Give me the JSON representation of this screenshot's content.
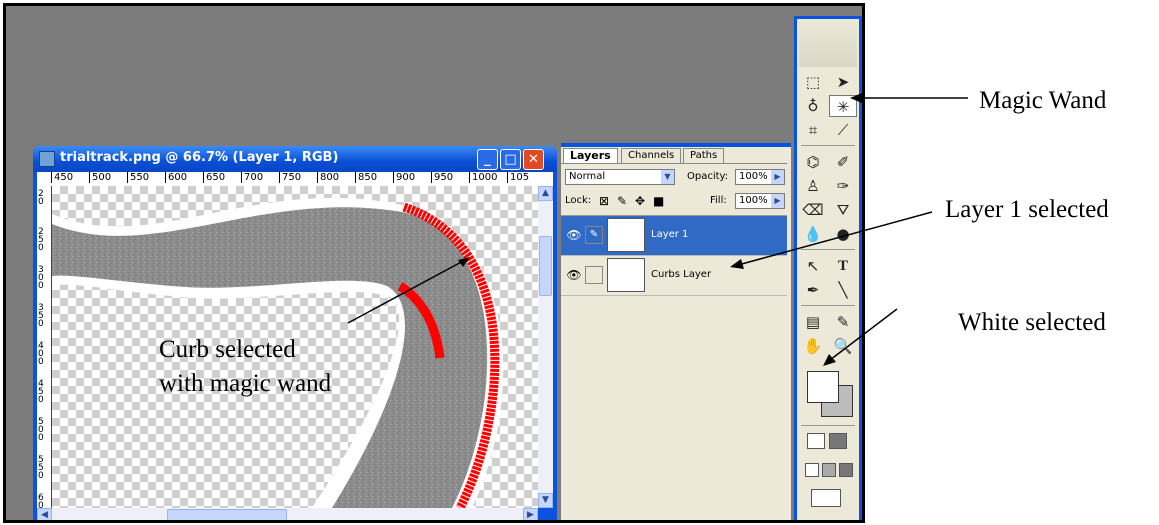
{
  "document_window": {
    "title": "trialtrack.png @ 66.7% (Layer 1, RGB)",
    "ruler_top_labels": [
      "450",
      "500",
      "550",
      "600",
      "650",
      "700",
      "750",
      "800",
      "850",
      "900",
      "950",
      "1000",
      "105"
    ],
    "ruler_left_labels": [
      "20",
      "250",
      "300",
      "350",
      "400",
      "450",
      "500",
      "550",
      "60"
    ],
    "canvas_annotation_lines": [
      "Curb selected",
      "with magic wand"
    ]
  },
  "layers_panel": {
    "tabs": [
      "Layers",
      "Channels",
      "Paths"
    ],
    "blend_mode": "Normal",
    "opacity_label": "Opacity:",
    "opacity_value": "100%",
    "lock_label": "Lock:",
    "fill_label": "Fill:",
    "fill_value": "100%",
    "layers": [
      {
        "name": "Layer 1",
        "selected": true
      },
      {
        "name": "Curbs Layer",
        "selected": false
      }
    ]
  },
  "toolbox": {
    "tools": [
      "marquee-icon",
      "move-icon",
      "lasso-icon",
      "magic-wand-icon",
      "crop-icon",
      "slice-icon",
      "healing-icon",
      "brush-icon",
      "stamp-icon",
      "history-brush-icon",
      "eraser-icon",
      "bucket-icon",
      "blur-icon",
      "dodge-icon",
      "path-select-icon",
      "type-icon",
      "pen-icon",
      "line-icon",
      "notes-icon",
      "eyedropper-icon",
      "hand-icon",
      "zoom-icon"
    ],
    "active_tool": "magic-wand-icon",
    "foreground_color": "#ffffff",
    "background_color": "#bcbcbc"
  },
  "callouts": {
    "magic_wand": "Magic Wand",
    "layer_selected": "Layer 1 selected",
    "white_selected": "White selected"
  },
  "colors": {
    "xp_blue": "#0a53df",
    "curb_red": "#ff0000",
    "track_gray": "#8e8e8e",
    "workspace_gray": "#7c7c7c"
  }
}
